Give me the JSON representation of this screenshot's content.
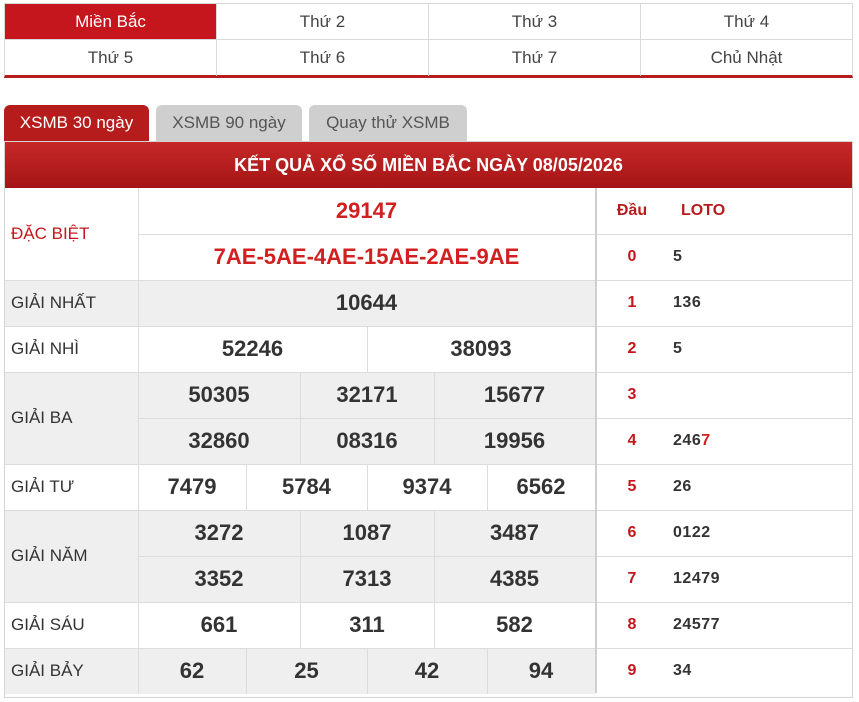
{
  "days": [
    "Miền Bắc",
    "Thứ 2",
    "Thứ 3",
    "Thứ 4",
    "Thứ 5",
    "Thứ 6",
    "Thứ 7",
    "Chủ Nhật"
  ],
  "tabs": [
    "XSMB 30 ngày",
    "XSMB 90 ngày",
    "Quay thử XSMB"
  ],
  "title": "KẾT QUẢ XỔ SỐ MIỀN BẮC NGÀY 08/05/2026",
  "prizes": {
    "special": {
      "label": "ĐẶC BIỆT",
      "number": "29147",
      "codes": "7AE-5AE-4AE-15AE-2AE-9AE"
    },
    "first": {
      "label": "GIẢI NHẤT",
      "numbers": [
        "10644"
      ]
    },
    "second": {
      "label": "GIẢI NHÌ",
      "numbers": [
        "52246",
        "38093"
      ]
    },
    "third": {
      "label": "GIẢI BA",
      "numbers": [
        "50305",
        "32171",
        "15677",
        "32860",
        "08316",
        "19956"
      ]
    },
    "fourth": {
      "label": "GIẢI TƯ",
      "numbers": [
        "7479",
        "5784",
        "9374",
        "6562"
      ]
    },
    "fifth": {
      "label": "GIẢI NĂM",
      "numbers": [
        "3272",
        "1087",
        "3487",
        "3352",
        "7313",
        "4385"
      ]
    },
    "sixth": {
      "label": "GIẢI SÁU",
      "numbers": [
        "661",
        "311",
        "582"
      ]
    },
    "seventh": {
      "label": "GIẢI BẢY",
      "numbers": [
        "62",
        "25",
        "42",
        "94"
      ]
    }
  },
  "loto": {
    "head_label": "Đầu",
    "loto_label": "LOTO",
    "rows": [
      {
        "dau": "0",
        "values": [
          "5"
        ]
      },
      {
        "dau": "1",
        "values": [
          "1",
          "3",
          "6"
        ]
      },
      {
        "dau": "2",
        "values": [
          "5"
        ]
      },
      {
        "dau": "3",
        "values": []
      },
      {
        "dau": "4",
        "values": [
          "2",
          "4",
          "6",
          "7"
        ],
        "highlight_index": 3
      },
      {
        "dau": "5",
        "values": [
          "2",
          "6"
        ]
      },
      {
        "dau": "6",
        "values": [
          "0",
          "1",
          "2",
          "2"
        ]
      },
      {
        "dau": "7",
        "values": [
          "1",
          "2",
          "4",
          "7",
          "9"
        ]
      },
      {
        "dau": "8",
        "values": [
          "2",
          "4",
          "5",
          "7",
          "7"
        ]
      },
      {
        "dau": "9",
        "values": [
          "3",
          "4"
        ]
      }
    ]
  },
  "colors": {
    "accent": "#c4161c",
    "shade": "#efefef",
    "border": "#dcdcdc"
  }
}
